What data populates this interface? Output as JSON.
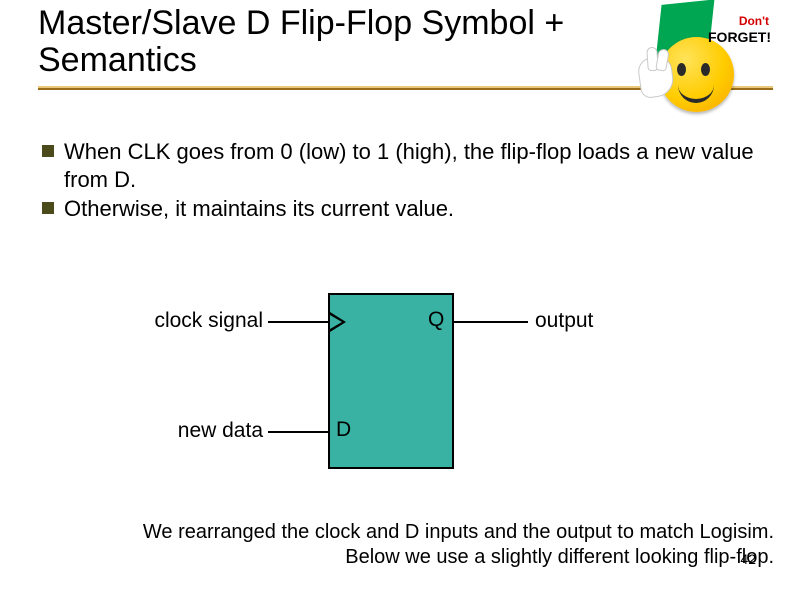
{
  "title": "Master/Slave D Flip-Flop Symbol + Semantics",
  "sticker": {
    "dont": "Don't",
    "forget": "FORGET!"
  },
  "bullets": [
    "When CLK goes from 0 (low) to 1 (high), the flip-flop loads a new value from D.",
    "Otherwise, it maintains its current value."
  ],
  "diagram": {
    "clock_label": "clock signal",
    "data_label": "new data",
    "output_label": "output",
    "pin_q": "Q",
    "pin_d": "D"
  },
  "note_line1": "We rearranged the clock and D inputs and the output to match Logisim.",
  "note_line2": "Below we use a slightly different looking flip-flop.",
  "page_number": "42"
}
